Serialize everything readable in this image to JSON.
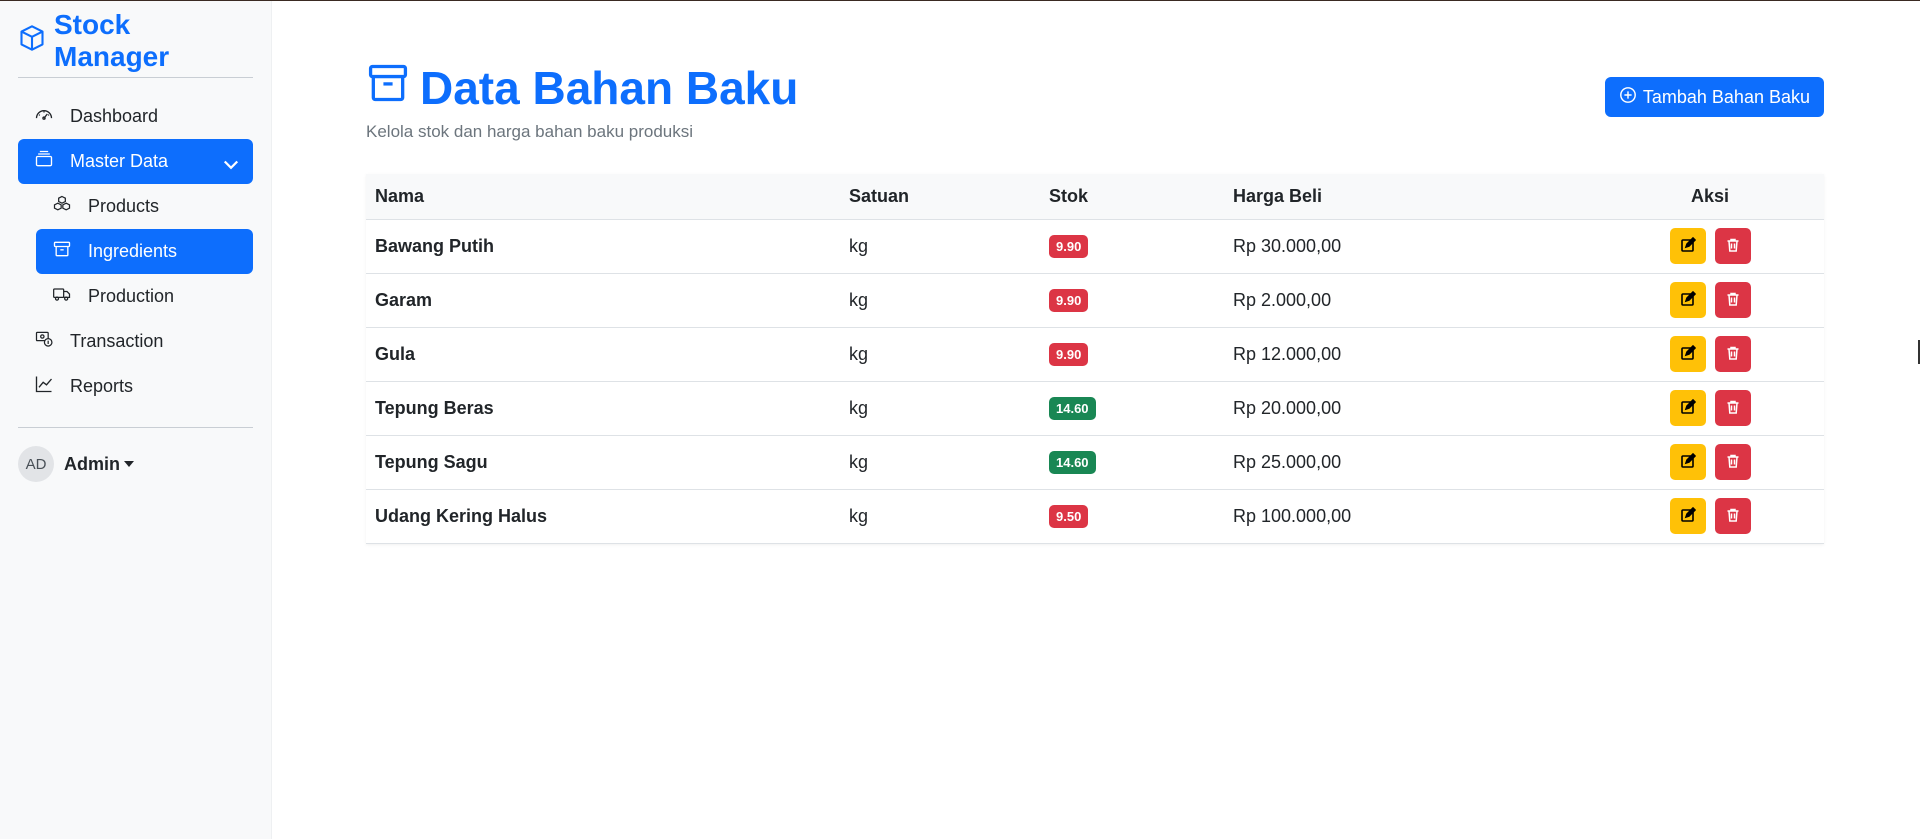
{
  "brand": {
    "name": "Stock Manager"
  },
  "sidebar": {
    "items": [
      {
        "label": "Dashboard"
      },
      {
        "label": "Master Data"
      },
      {
        "label": "Products"
      },
      {
        "label": "Ingredients"
      },
      {
        "label": "Production"
      },
      {
        "label": "Transaction"
      },
      {
        "label": "Reports"
      }
    ],
    "active_group": "Master Data",
    "active_item": "Ingredients",
    "accent_color": "#0d6efd"
  },
  "user": {
    "initials": "AD",
    "name": "Admin"
  },
  "page": {
    "title": "Data Bahan Baku",
    "subtitle": "Kelola stok dan harga bahan baku produksi",
    "add_button": "Tambah Bahan Baku"
  },
  "table": {
    "headers": [
      "Nama",
      "Satuan",
      "Stok",
      "Harga Beli",
      "Aksi"
    ],
    "rows": [
      {
        "name": "Bawang Putih",
        "unit": "kg",
        "stock": "9.90",
        "stock_status": "low",
        "price": "Rp 30.000,00"
      },
      {
        "name": "Garam",
        "unit": "kg",
        "stock": "9.90",
        "stock_status": "low",
        "price": "Rp 2.000,00"
      },
      {
        "name": "Gula",
        "unit": "kg",
        "stock": "9.90",
        "stock_status": "low",
        "price": "Rp 12.000,00"
      },
      {
        "name": "Tepung Beras",
        "unit": "kg",
        "stock": "14.60",
        "stock_status": "ok",
        "price": "Rp 20.000,00"
      },
      {
        "name": "Tepung Sagu",
        "unit": "kg",
        "stock": "14.60",
        "stock_status": "ok",
        "price": "Rp 25.000,00"
      },
      {
        "name": "Udang Kering Halus",
        "unit": "kg",
        "stock": "9.50",
        "stock_status": "low",
        "price": "Rp 100.000,00"
      }
    ],
    "status_colors": {
      "low": "#dc3545",
      "ok": "#198754"
    },
    "edit_color": "#ffc107",
    "delete_color": "#dc3545"
  }
}
